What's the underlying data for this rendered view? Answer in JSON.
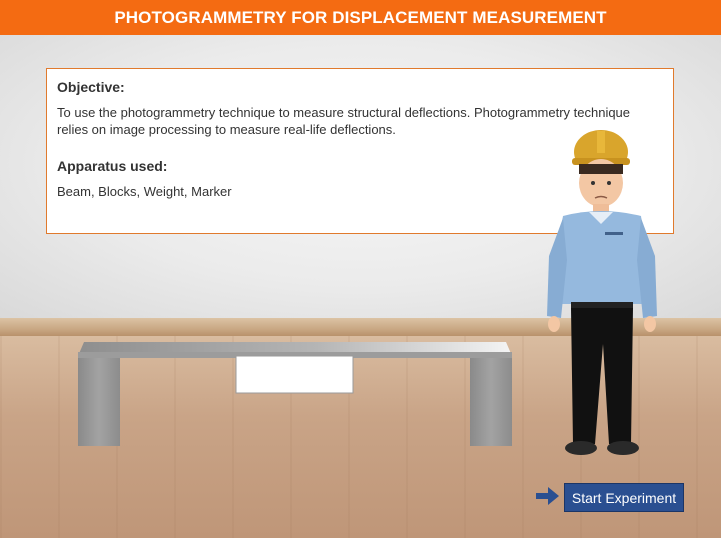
{
  "header": {
    "title": "PHOTOGRAMMETRY FOR DISPLACEMENT MEASUREMENT"
  },
  "info": {
    "objective_heading": "Objective:",
    "objective_text": "To use the photogrammetry technique to measure structural deflections. Photogrammetry technique relies on image processing to measure real-life deflections.",
    "apparatus_heading": "Apparatus used:",
    "apparatus_text": "Beam, Blocks, Weight, Marker"
  },
  "actions": {
    "start_label": "Start Experiment",
    "arrow_icon": "arrow-right-icon"
  },
  "colors": {
    "accent": "#f46b12",
    "button": "#2a4f91"
  }
}
